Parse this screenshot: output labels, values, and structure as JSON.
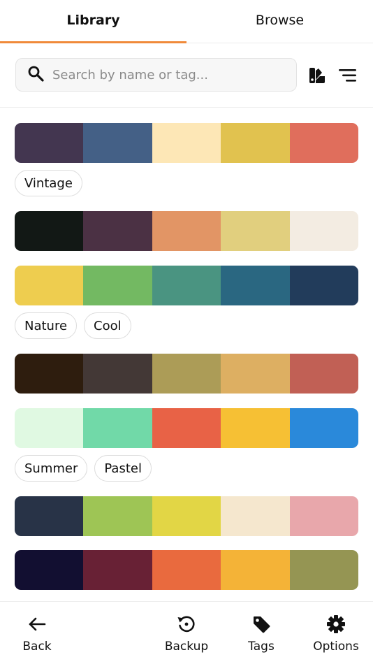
{
  "tabs": [
    {
      "label": "Library",
      "active": true
    },
    {
      "label": "Browse",
      "active": false
    }
  ],
  "search": {
    "placeholder": "Search by name or tag...",
    "value": ""
  },
  "toolbar": {
    "swatch_icon": "swatch-book-icon",
    "sort_icon": "sort-lines-icon"
  },
  "accent_color": "#f08a3a",
  "palettes": [
    {
      "colors": [
        "#433650",
        "#446086",
        "#fde7b6",
        "#e1c24f",
        "#e06e5c"
      ],
      "tags": [
        "Vintage"
      ]
    },
    {
      "colors": [
        "#121815",
        "#4b3144",
        "#e29565",
        "#e1cf7e",
        "#f3ece2"
      ],
      "tags": []
    },
    {
      "colors": [
        "#eecd4f",
        "#73b962",
        "#4a9481",
        "#2a6781",
        "#223c5b"
      ],
      "tags": [
        "Nature",
        "Cool"
      ]
    },
    {
      "colors": [
        "#2e1d0e",
        "#433836",
        "#ac9c57",
        "#ddaf62",
        "#c16055"
      ],
      "tags": []
    },
    {
      "colors": [
        "#e0f9e2",
        "#71d9a8",
        "#e86246",
        "#f6c034",
        "#2a89da"
      ],
      "tags": [
        "Summer",
        "Pastel"
      ]
    },
    {
      "colors": [
        "#283347",
        "#9ec555",
        "#e2d645",
        "#f5e7ce",
        "#e8a7ab"
      ],
      "tags": []
    },
    {
      "colors": [
        "#120f31",
        "#682135",
        "#e96a3e",
        "#f4b337",
        "#959553"
      ],
      "tags": []
    }
  ],
  "bottom_nav": [
    {
      "label": "Back",
      "icon": "arrow-left-icon"
    },
    {
      "label": "Backup",
      "icon": "backup-restore-icon"
    },
    {
      "label": "Tags",
      "icon": "tag-icon"
    },
    {
      "label": "Options",
      "icon": "gear-icon"
    }
  ]
}
